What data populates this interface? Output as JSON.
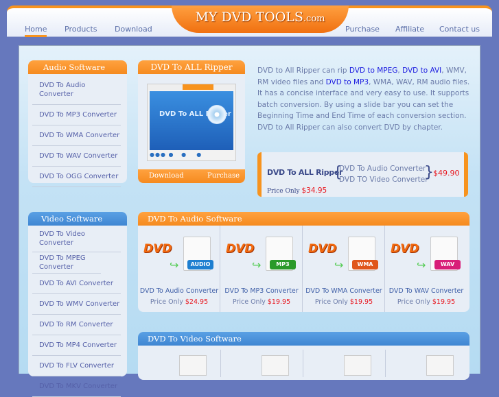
{
  "header": {
    "logo": "MY DVD TOOLS",
    "logo_suffix": ".com",
    "nav_left": [
      "Home",
      "Products",
      "Download"
    ],
    "nav_right": [
      "Purchase",
      "Affiliate",
      "Contact us"
    ]
  },
  "audio_sidebar": {
    "title": "Audio Software",
    "items": [
      "DVD To Audio Converter",
      "DVD To MP3 Converter",
      "DVD To WMA Converter",
      "DVD To WAV Converter",
      "DVD To OGG Converter"
    ]
  },
  "video_sidebar": {
    "title": "Video Software",
    "items": [
      "DVD To Video Converter",
      "DVD To MPEG Converter",
      "DVD To AVI Converter",
      "DVD To WMV Converter",
      "DVD To RM Converter",
      "DVD To MP4 Converter",
      "DVD To FLV Converter",
      "DVD To MKV Converter"
    ]
  },
  "ripper": {
    "title": "DVD To ALL Ripper",
    "screenshot_text": "DVD To ALL Ripper",
    "download": "Download",
    "purchase": "Purchase"
  },
  "description": {
    "p1": "DVD to All Ripper can rip ",
    "l1": "DVD to MPEG",
    "p2": ", ",
    "l2": "DVD to AVI",
    "p3": ", WMV, RM video files and ",
    "l3": "DVD to MP3",
    "p4": ", WMA, WAV, RM audio files. It has a concise interface and very easy to use. It supports batch conversion. By using a slide bar you can set the Beginning Time and End Time of each conversion section. DVD to All Ripper can also convert DVD by chapter."
  },
  "promo": {
    "title": "DVD To ALL Ripper",
    "items": [
      "DVD To Audio Converter",
      "DVD TO Video Converter"
    ],
    "bundle_price": "$49.90",
    "price_label": "Price Only",
    "price": "$34.95"
  },
  "audio_section": {
    "title": "DVD To Audio Software",
    "products": [
      {
        "name": "DVD To Audio Converter",
        "tag": "AUDIO",
        "tag_color": "#1e7fd0",
        "price_label": "Price Only",
        "price": "$24.95"
      },
      {
        "name": "DVD To MP3 Converter",
        "tag": "MP3",
        "tag_color": "#2a9a2a",
        "price_label": "Price Only",
        "price": "$19.95"
      },
      {
        "name": "DVD To WMA Converter",
        "tag": "WMA",
        "tag_color": "#e0561a",
        "price_label": "Price Only",
        "price": "$19.95"
      },
      {
        "name": "DVD To WAV Converter",
        "tag": "WAV",
        "tag_color": "#d81e78",
        "price_label": "Price Only",
        "price": "$19.95"
      }
    ]
  },
  "video_section": {
    "title": "DVD To Video Software"
  }
}
